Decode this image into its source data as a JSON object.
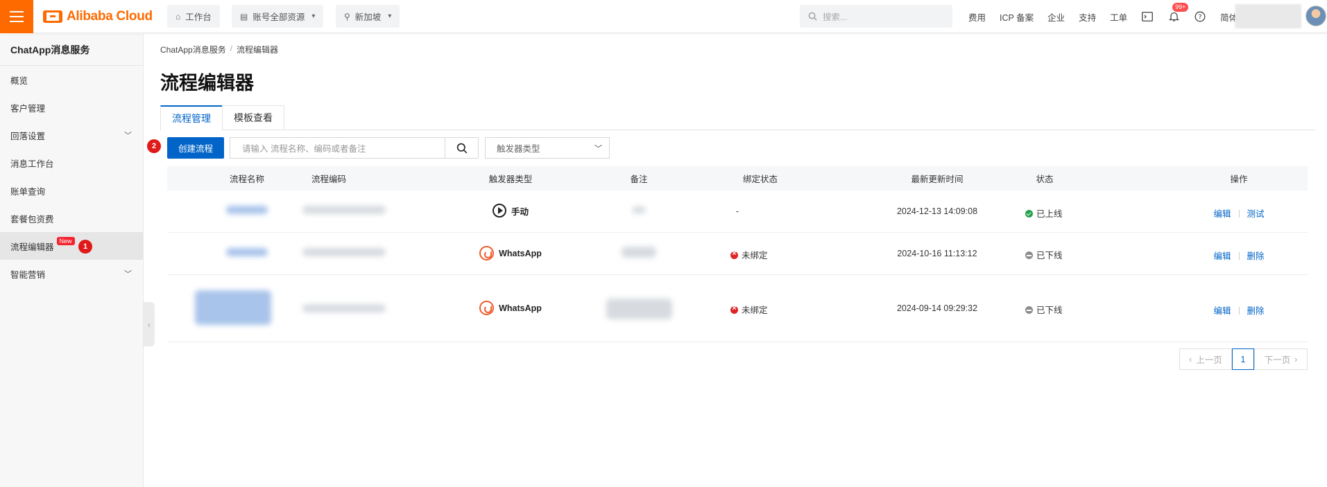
{
  "topbar": {
    "brand": "Alibaba Cloud",
    "workbench": "工作台",
    "resources": "账号全部资源",
    "region": "新加坡",
    "search_placeholder": "搜索...",
    "links": [
      "费用",
      "ICP 备案",
      "企业",
      "支持",
      "工单"
    ],
    "notification_count": "99+",
    "language": "简体"
  },
  "sidebar": {
    "title": "ChatApp消息服务",
    "items": [
      {
        "label": "概览"
      },
      {
        "label": "客户管理"
      },
      {
        "label": "回落设置"
      },
      {
        "label": "消息工作台"
      },
      {
        "label": "账单查询"
      },
      {
        "label": "套餐包资费"
      },
      {
        "label": "流程编辑器",
        "badge": "New"
      },
      {
        "label": "智能营销"
      }
    ],
    "marker_1": "1"
  },
  "breadcrumb": [
    "ChatApp消息服务",
    "流程编辑器"
  ],
  "page_title": "流程编辑器",
  "tabs": [
    "流程管理",
    "模板查看"
  ],
  "toolbar": {
    "create_label": "创建流程",
    "marker_2": "2",
    "search_placeholder": "请输入 流程名称、编码或者备注",
    "trigger_select_placeholder": "触发器类型"
  },
  "table": {
    "columns": [
      "流程名称",
      "流程编码",
      "触发器类型",
      "备注",
      "绑定状态",
      "最新更新时间",
      "状态",
      "操作"
    ],
    "rows": [
      {
        "trigger": "手动",
        "binding": "-",
        "updated": "2024-12-13 14:09:08",
        "status": "已上线",
        "actions": [
          "编辑",
          "测试"
        ]
      },
      {
        "trigger": "WhatsApp",
        "binding": "未绑定",
        "updated": "2024-10-16 11:13:12",
        "status": "已下线",
        "actions": [
          "编辑",
          "删除"
        ]
      },
      {
        "trigger": "WhatsApp",
        "binding": "未绑定",
        "updated": "2024-09-14 09:29:32",
        "status": "已下线",
        "actions": [
          "编辑",
          "删除"
        ]
      }
    ]
  },
  "pagination": {
    "prev": "上一页",
    "current": "1",
    "next": "下一页"
  },
  "colors": {
    "brand_orange": "#ff6a00",
    "primary_blue": "#0064c8",
    "badge_red": "#e01a1a"
  }
}
